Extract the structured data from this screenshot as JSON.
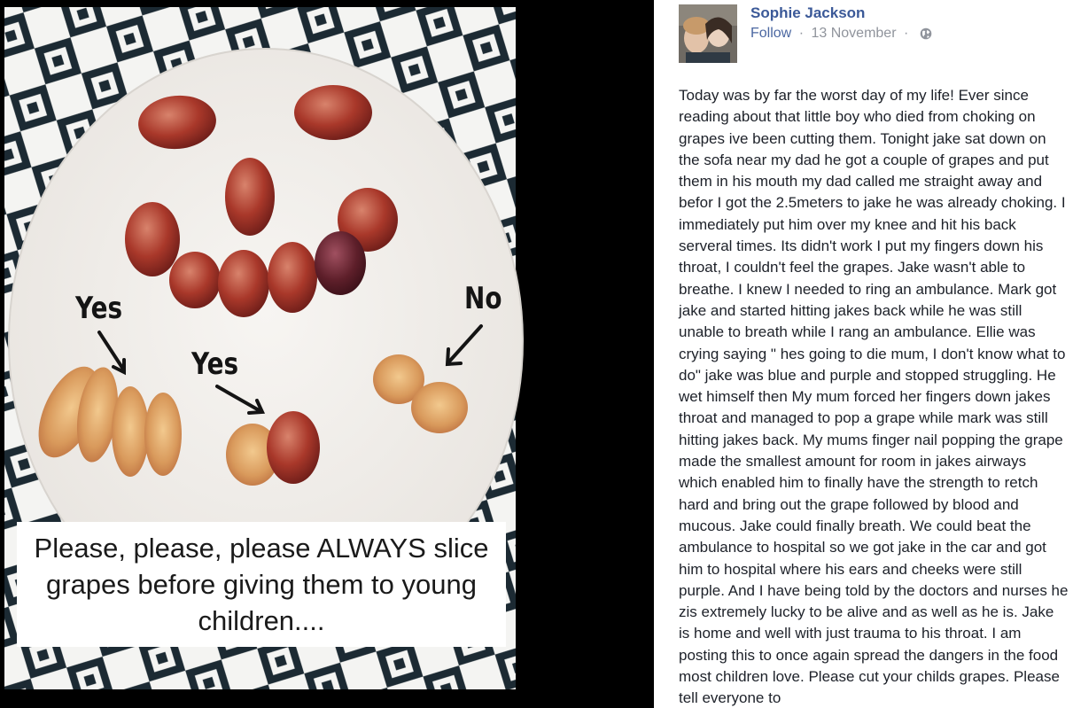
{
  "photo": {
    "labels": {
      "yes_left": "Yes",
      "yes_center": "Yes",
      "no": "No"
    },
    "caption": "Please, please, please ALWAYS slice grapes before giving them to young children...."
  },
  "post": {
    "author": "Sophie Jackson",
    "follow_label": "Follow",
    "separator": "·",
    "date": "13 November",
    "privacy_icon": "globe-icon",
    "text": "Today was by far the worst day of my life! Ever since reading about that little boy who died from choking on grapes ive been cutting them. Tonight jake sat down on the sofa near my dad he got a couple of grapes and put them in his mouth my dad called me straight away and befor I got the 2.5meters to jake he was already choking. I immediately put him over my knee and hit his back serveral times. Its didn't work I put my fingers down his throat, I couldn't feel the grapes. Jake wasn't able to breathe. I knew I needed to ring an ambulance. Mark got jake and started hitting jakes back while he was still unable to breath while I rang an ambulance. Ellie was crying saying \" hes going to die mum, I don't know what to do\" jake was blue and purple and stopped struggling. He wet himself then My mum forced her fingers down jakes throat and managed to pop a grape while mark was still hitting jakes back. My mums finger nail popping the grape made the smallest amount for room in jakes airways which enabled him to finally have the strength to retch hard and bring out the grape followed by blood and mucous. Jake could finally breath. We could beat the ambulance to hospital so we got jake in the car and got him to hospital where his ears and cheeks were still purple. And I have being told by the doctors and nurses he zis extremely lucky to be alive and as well as he is. Jake is home and well with just trauma to his throat. I am posting this to once again spread the dangers in the food most children love. Please cut your childs grapes. Please tell everyone to"
  },
  "colors": {
    "author_link": "#3b5998",
    "follow_link": "#4b67a1",
    "meta_gray": "#90949c",
    "body_text": "#1d2129",
    "viewer_bg": "#000000"
  }
}
